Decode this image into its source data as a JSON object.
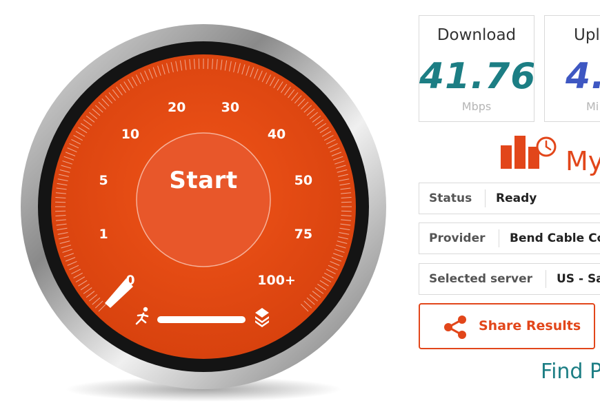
{
  "gauge": {
    "start_label": "Start",
    "scale_labels": [
      "0",
      "1",
      "5",
      "10",
      "20",
      "30",
      "40",
      "50",
      "75",
      "100+"
    ],
    "needle_value": "0",
    "progress": 0,
    "colors": {
      "dial": "#e04611",
      "dial_dark": "#c23a0c",
      "bezel": "#999999",
      "ring": "#111111"
    }
  },
  "results": {
    "download": {
      "title": "Download",
      "value": "41.76",
      "unit": "Mbps"
    },
    "upload": {
      "title": "Upl",
      "value": "4.",
      "unit": "Mi"
    }
  },
  "my_results_label": "My",
  "info": {
    "status": {
      "label": "Status",
      "value": "Ready"
    },
    "provider": {
      "label": "Provider",
      "value": "Bend Cable Co"
    },
    "server": {
      "label": "Selected server",
      "value": "US - Sa"
    }
  },
  "share_label": "Share Results",
  "find_label": "Find P",
  "colors": {
    "accent": "#e2461a",
    "download_value": "#1c7e84",
    "upload_value": "#3e57c2"
  }
}
